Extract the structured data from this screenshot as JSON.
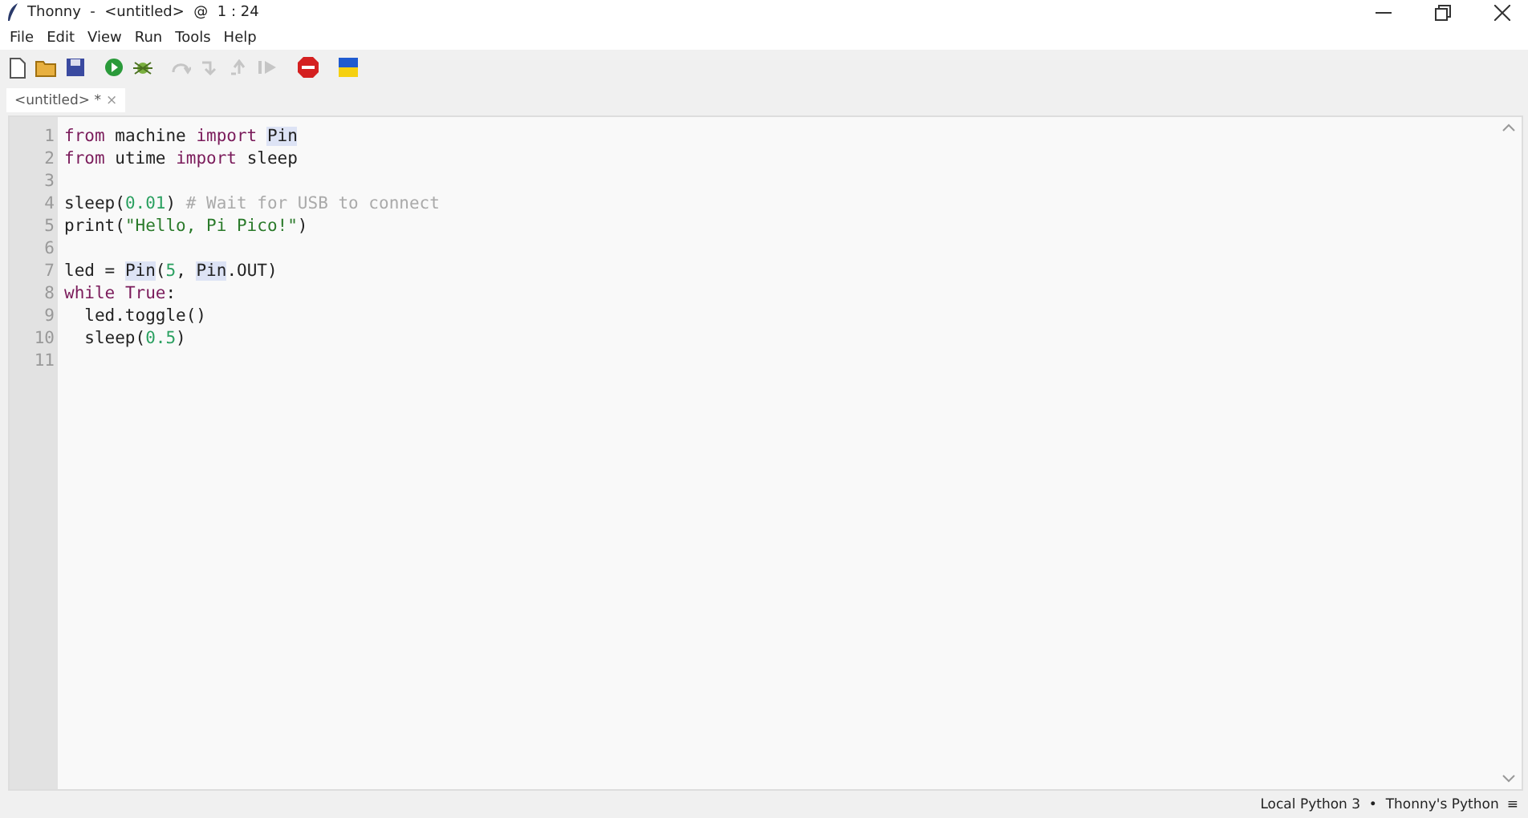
{
  "window": {
    "title": "Thonny  -  <untitled>  @  1 : 24"
  },
  "menu": [
    "File",
    "Edit",
    "View",
    "Run",
    "Tools",
    "Help"
  ],
  "toolbar": [
    {
      "kind": "new",
      "disabled": false
    },
    {
      "kind": "open",
      "disabled": false
    },
    {
      "kind": "save",
      "disabled": false
    },
    {
      "kind": "run",
      "disabled": false
    },
    {
      "kind": "debug",
      "disabled": false
    },
    {
      "kind": "step-over",
      "disabled": true
    },
    {
      "kind": "step-into",
      "disabled": true
    },
    {
      "kind": "step-out",
      "disabled": true
    },
    {
      "kind": "resume",
      "disabled": true
    },
    {
      "kind": "stop",
      "disabled": false
    },
    {
      "kind": "flag",
      "disabled": false
    }
  ],
  "tabs": [
    {
      "label": "<untitled> *",
      "close": "×",
      "selected": true
    }
  ],
  "code": [
    {
      "number": "1",
      "tokens": [
        {
          "text": "from",
          "kind": "keyword"
        },
        {
          "text": " machine ",
          "kind": "plain"
        },
        {
          "text": "import ",
          "kind": "keyword"
        },
        {
          "text": "Pin",
          "kind": "match"
        }
      ]
    },
    {
      "number": "2",
      "tokens": [
        {
          "text": "from",
          "kind": "keyword"
        },
        {
          "text": " utime ",
          "kind": "plain"
        },
        {
          "text": "import",
          "kind": "keyword"
        },
        {
          "text": " sleep",
          "kind": "plain"
        }
      ]
    },
    {
      "number": "3"
    },
    {
      "number": "4",
      "tokens": [
        {
          "text": "sleep(",
          "kind": "plain"
        },
        {
          "text": "0.01",
          "kind": "number"
        },
        {
          "text": ") ",
          "kind": "plain"
        },
        {
          "text": "# Wait for USB to connect",
          "kind": "comment"
        }
      ]
    },
    {
      "number": "5",
      "tokens": [
        {
          "text": "print(",
          "kind": "plain"
        },
        {
          "text": "\"Hello, Pi Pico!\"",
          "kind": "string"
        },
        {
          "text": ")",
          "kind": "plain"
        }
      ]
    },
    {
      "number": "6"
    },
    {
      "number": "7",
      "tokens": [
        {
          "text": "led = ",
          "kind": "plain"
        },
        {
          "text": "Pin",
          "kind": "match"
        },
        {
          "text": "(",
          "kind": "plain"
        },
        {
          "text": "5",
          "kind": "number"
        },
        {
          "text": ", ",
          "kind": "plain"
        },
        {
          "text": "Pin",
          "kind": "match"
        },
        {
          "text": ".OUT)",
          "kind": "plain"
        }
      ]
    },
    {
      "number": "8",
      "tokens": [
        {
          "text": "while ",
          "kind": "keyword"
        },
        {
          "text": "True",
          "kind": "keyword"
        },
        {
          "text": ":",
          "kind": "plain"
        }
      ]
    },
    {
      "number": "9",
      "tokens": [
        {
          "text": "  led.toggle()",
          "kind": "plain"
        }
      ]
    },
    {
      "number": "10",
      "tokens": [
        {
          "text": "  sleep(",
          "kind": "plain"
        },
        {
          "text": "0.5",
          "kind": "number"
        },
        {
          "text": ")",
          "kind": "plain"
        }
      ]
    },
    {
      "number": "11"
    }
  ],
  "status_bar": {
    "interpreter": "Local Python 3  •  Thonny's Python",
    "menu": "≡"
  }
}
